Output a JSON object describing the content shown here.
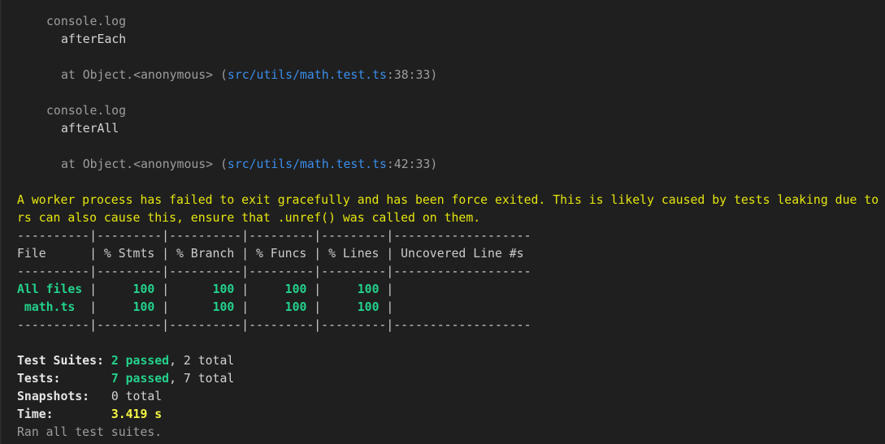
{
  "console_entries": [
    {
      "label": "console.log",
      "message": "afterEach",
      "at_prefix": "at Object.<anonymous> (",
      "file": "src/utils/math.test.ts",
      "position": ":38:33)"
    },
    {
      "label": "console.log",
      "message": "afterAll",
      "at_prefix": "at Object.<anonymous> (",
      "file": "src/utils/math.test.ts",
      "position": ":42:33)"
    }
  ],
  "warning": {
    "line1": "A worker process has failed to exit gracefully and has been force exited. This is likely caused by tests leaking due to",
    "line2": "rs can also cause this, ensure that .unref() was called on them."
  },
  "coverage": {
    "separator": "----------|---------|----------|---------|---------|-------------------",
    "header": "File      | % Stmts | % Branch | % Funcs | % Lines | Uncovered Line #s",
    "rows": [
      {
        "file": "All files",
        "file_pad": "All files ",
        "stmts": "100",
        "branch": "100",
        "funcs": "100",
        "lines": "100"
      },
      {
        "file": "math.ts",
        "file_pad": " math.ts  ",
        "stmts": "100",
        "branch": "100",
        "funcs": "100",
        "lines": "100"
      }
    ]
  },
  "summary": {
    "suites_label": "Test Suites:",
    "suites_passed": "2 passed",
    "suites_total": ", 2 total",
    "tests_label": "Tests:",
    "tests_passed": "7 passed",
    "tests_total": ", 7 total",
    "snapshots_label": "Snapshots:",
    "snapshots_value": "0 total",
    "time_label": "Time:",
    "time_value": "3.419 s",
    "ran_all": "Ran all test suites."
  },
  "colors": {
    "background": "#1f1f1f",
    "link": "#3b8eea",
    "warning": "#e5e510",
    "pass": "#23d18b",
    "time": "#f5f543"
  }
}
